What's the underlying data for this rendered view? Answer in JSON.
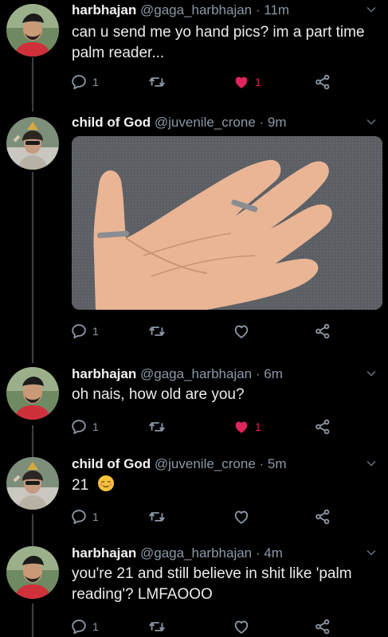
{
  "tweets": [
    {
      "name": "harbhajan",
      "handle": "@gaga_harbhajan",
      "time": "· 11m",
      "text_lines": [
        "can u send me yo hand pics? im a part time",
        "palm reader..."
      ],
      "reply_count": "1",
      "like_count": "1",
      "liked": true
    },
    {
      "name": "child of God",
      "handle": "@juvenile_crone",
      "time": "· 9m",
      "has_photo": true,
      "reply_count": "1",
      "like_count": "",
      "liked": false
    },
    {
      "name": "harbhajan",
      "handle": "@gaga_harbhajan",
      "time": "· 6m",
      "text_lines": [
        "oh nais, how old are you?"
      ],
      "reply_count": "1",
      "like_count": "1",
      "liked": true
    },
    {
      "name": "child of God",
      "handle": "@juvenile_crone",
      "time": "· 5m",
      "text_lines": [
        "21"
      ],
      "emoji": "relieved-face-emoji",
      "reply_count": "1",
      "like_count": "",
      "liked": false
    },
    {
      "name": "harbhajan",
      "handle": "@gaga_harbhajan",
      "time": "· 4m",
      "text_lines": [
        "you're 21 and still believe in shit like 'palm",
        "reading'? LMFAOOO"
      ],
      "reply_count": "1",
      "like_count": "",
      "liked": false
    }
  ],
  "icons": {
    "reply": "reply-icon",
    "retweet": "retweet-icon",
    "like": "heart-icon",
    "share": "share-icon",
    "more": "chevron-down-icon"
  },
  "colors": {
    "background": "#000000",
    "liked": "#e0245e",
    "muted": "#8b98a5"
  }
}
